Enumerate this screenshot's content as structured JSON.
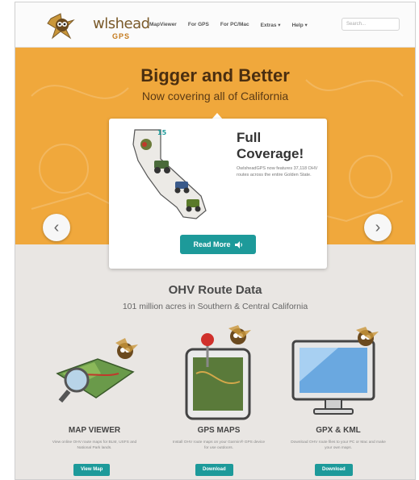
{
  "header": {
    "logo_text": "wlshead",
    "logo_sub": "GPS",
    "nav": [
      "MapViewer",
      "For GPS",
      "For PC/Mac",
      "Extras ▾",
      "Help ▾"
    ],
    "search_placeholder": "Search..."
  },
  "hero": {
    "title": "Bigger and Better",
    "subtitle": "Now covering all of California",
    "card": {
      "title": "Full Coverage!",
      "text": "OwlsheadGPS now features 37,118 OHV routes across the entire Golden State.",
      "button_label": "Read More",
      "button_icon": "volume-icon"
    },
    "prev_label": "‹",
    "next_label": "›"
  },
  "section": {
    "title": "OHV Route Data",
    "subtitle": "101 million acres in Southern & Central California"
  },
  "features": [
    {
      "title": "MAP VIEWER",
      "text": "View online OHV route maps for BLM, USFS and National Park lands.",
      "button": "View Map",
      "icon": "map-icon"
    },
    {
      "title": "GPS MAPS",
      "text": "Install OHV route maps on your Garmin® GPS device for use outdoors.",
      "button": "Download",
      "icon": "gps-icon"
    },
    {
      "title": "GPX & KML",
      "text": "Download OHV route files to your PC or Mac and make your own maps.",
      "button": "Download",
      "icon": "monitor-icon"
    }
  ],
  "colors": {
    "hero_orange": "#f0a83c",
    "accent_teal": "#1d9a9a",
    "page_bg": "#e9e6e3"
  }
}
